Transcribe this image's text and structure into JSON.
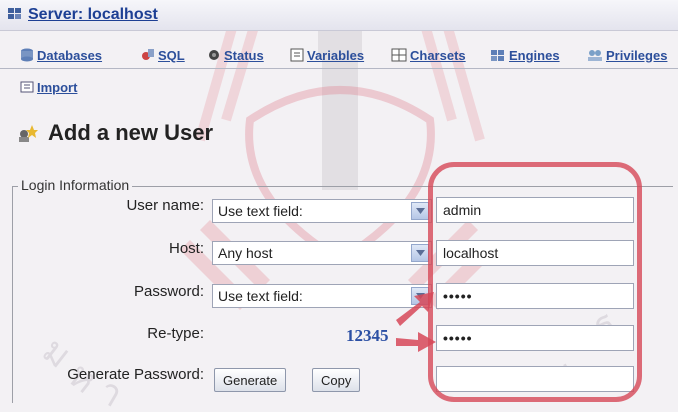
{
  "server": {
    "title": "Server: localhost",
    "icon": "server-icon"
  },
  "tabs": [
    {
      "label": "Databases",
      "icon": "database-icon"
    },
    {
      "label": "SQL",
      "icon": "sql-icon"
    },
    {
      "label": "Status",
      "icon": "status-icon"
    },
    {
      "label": "Variables",
      "icon": "variables-icon"
    },
    {
      "label": "Charsets",
      "icon": "charsets-icon"
    },
    {
      "label": "Engines",
      "icon": "engines-icon"
    },
    {
      "label": "Privileges",
      "icon": "privileges-icon"
    },
    {
      "label": "Import",
      "icon": "import-icon"
    }
  ],
  "page": {
    "title": "Add a new User",
    "icon": "add-user-icon"
  },
  "login": {
    "legend": "Login Information",
    "username": {
      "label": "User name:",
      "select": "Use text field:",
      "value": "admin"
    },
    "host": {
      "label": "Host:",
      "select": "Any host",
      "value": "localhost"
    },
    "password": {
      "label": "Password:",
      "select": "Use text field:",
      "value": "•••••"
    },
    "retype": {
      "label": "Re-type:",
      "value": "•••••"
    },
    "generate": {
      "label": "Generate Password:",
      "generate_button": "Generate",
      "copy_button": "Copy",
      "value": ""
    }
  },
  "annotation": {
    "password_hint": "12345",
    "highlight_color": "#d64858"
  }
}
